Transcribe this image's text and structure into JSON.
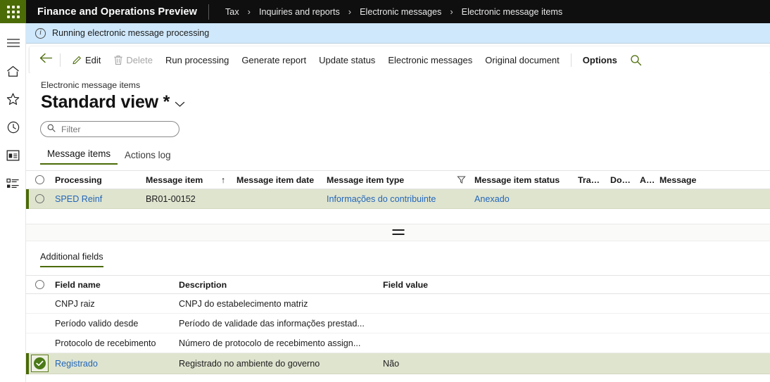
{
  "topbar": {
    "waffle_label": "app-launcher",
    "app_title": "Finance and Operations Preview",
    "breadcrumb": [
      "Tax",
      "Inquiries and reports",
      "Electronic messages",
      "Electronic message items"
    ],
    "separator": "›"
  },
  "navrail": {
    "items": [
      {
        "name": "menu-icon",
        "label": "Expand the navigation pane"
      },
      {
        "name": "home-icon",
        "label": "Home"
      },
      {
        "name": "star-icon",
        "label": "Favorites"
      },
      {
        "name": "clock-icon",
        "label": "Recent"
      },
      {
        "name": "workspace-icon",
        "label": "Workspaces"
      },
      {
        "name": "modules-icon",
        "label": "Modules"
      }
    ]
  },
  "notification": {
    "icon": "info-icon",
    "text": "Running electronic message processing",
    "background": "#cfe8fb"
  },
  "command_bar": {
    "back_label": "Back",
    "buttons": [
      {
        "label": "Edit",
        "icon": "pencil-icon",
        "disabled": false,
        "bold": false
      },
      {
        "label": "Delete",
        "icon": "trash-icon",
        "disabled": true,
        "bold": false
      },
      {
        "label": "Run processing",
        "icon": "",
        "disabled": false,
        "bold": false
      },
      {
        "label": "Generate report",
        "icon": "",
        "disabled": false,
        "bold": false
      },
      {
        "label": "Update status",
        "icon": "",
        "disabled": false,
        "bold": false
      },
      {
        "label": "Electronic messages",
        "icon": "",
        "disabled": false,
        "bold": false
      },
      {
        "label": "Original document",
        "icon": "",
        "disabled": false,
        "bold": false
      },
      {
        "label": "Options",
        "icon": "",
        "disabled": false,
        "bold": true
      }
    ],
    "search_icon": "search-icon"
  },
  "page": {
    "caption": "Electronic message items",
    "view_title": "Standard view *",
    "filter_placeholder": "Filter",
    "filter_value": ""
  },
  "tabs": [
    {
      "label": "Message items",
      "active": true
    },
    {
      "label": "Actions log",
      "active": false
    }
  ],
  "message_items_grid": {
    "columns": [
      "Processing",
      "Message item",
      "Message item date",
      "Message item type",
      "Message item status",
      "Trans...",
      "Doc...",
      "A...",
      "Message"
    ],
    "sort_indicator": "↑",
    "sort_column": "Message item",
    "filter_icon_column": "Message item type",
    "rows": [
      {
        "selected": true,
        "processing": "SPED Reinf",
        "message_item": "BR01-00152",
        "message_item_date": "",
        "message_item_type": "Informações do contribuinte",
        "message_item_status": "Anexado",
        "trans": "",
        "doc": "",
        "a": "",
        "message": ""
      }
    ]
  },
  "additional_fields": {
    "section_title": "Additional fields",
    "columns": [
      "Field name",
      "Description",
      "Field value"
    ],
    "rows": [
      {
        "selected": false,
        "field_name": "CNPJ raiz",
        "description": "CNPJ do estabelecimento matriz",
        "field_value": ""
      },
      {
        "selected": false,
        "field_name": "Período valido desde",
        "description": "Período de validade das informações prestad...",
        "field_value": ""
      },
      {
        "selected": false,
        "field_name": "Protocolo de recebimento",
        "description": "Número de protocolo de recebimento assign...",
        "field_value": ""
      },
      {
        "selected": true,
        "field_name": "Registrado",
        "description": "Registrado no ambiente do governo",
        "field_value": "Não"
      }
    ]
  },
  "colors": {
    "brand_green": "#4b6b07",
    "selection_row": "#dfe4cf",
    "link": "#2266b8",
    "topbar": "#0f0f0f",
    "info_bar": "#cfe8fb"
  }
}
